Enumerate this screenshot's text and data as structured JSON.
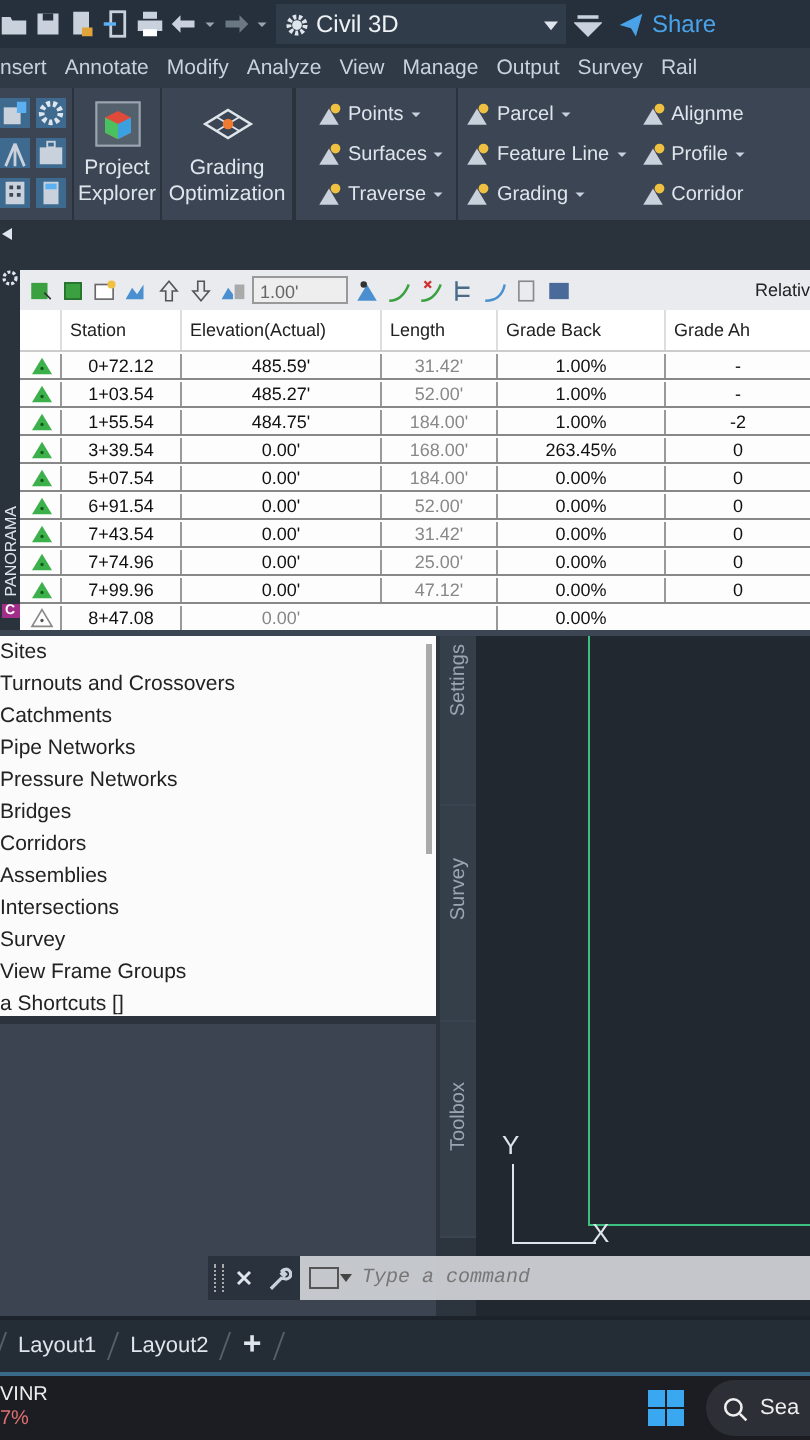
{
  "title_bar": {
    "workspace": "Civil 3D",
    "share": "Share"
  },
  "menu_tabs": [
    "nsert",
    "Annotate",
    "Modify",
    "Analyze",
    "View",
    "Manage",
    "Output",
    "Survey",
    "Rail"
  ],
  "ribbon": {
    "big_buttons": [
      {
        "label": "Project Explorer",
        "kind": "explorer"
      },
      {
        "label": "Grading Optimization",
        "kind": "grading"
      }
    ],
    "tool_columns": [
      [
        {
          "label": "Points",
          "dropdown": true
        },
        {
          "label": "Surfaces",
          "dropdown": true
        },
        {
          "label": "Traverse",
          "dropdown": true
        }
      ],
      [
        {
          "label": "Parcel",
          "dropdown": true
        },
        {
          "label": "Feature Line",
          "dropdown": true
        },
        {
          "label": "Grading",
          "dropdown": true
        }
      ],
      [
        {
          "label": "Alignme",
          "dropdown": false
        },
        {
          "label": "Profile",
          "dropdown": true
        },
        {
          "label": "Corridor",
          "dropdown": false
        }
      ]
    ]
  },
  "panorama": {
    "title": "PANORAMA",
    "badge": "C",
    "toolbar": {
      "value": "1.00'",
      "relative": "Relativ"
    },
    "columns": [
      "Station",
      "Elevation(Actual)",
      "Length",
      "Grade Back",
      "Grade Ah"
    ],
    "rows": [
      {
        "kind": "pvi",
        "cells": [
          "0+72.12",
          "485.59'",
          "31.42'",
          "1.00%",
          "-"
        ]
      },
      {
        "kind": "pvi",
        "cells": [
          "1+03.54",
          "485.27'",
          "52.00'",
          "1.00%",
          "-"
        ]
      },
      {
        "kind": "pvi",
        "cells": [
          "1+55.54",
          "484.75'",
          "184.00'",
          "1.00%",
          "-2"
        ]
      },
      {
        "kind": "pvi",
        "cells": [
          "3+39.54",
          "0.00'",
          "168.00'",
          "263.45%",
          "0"
        ]
      },
      {
        "kind": "pvi",
        "cells": [
          "5+07.54",
          "0.00'",
          "184.00'",
          "0.00%",
          "0"
        ]
      },
      {
        "kind": "pvi",
        "cells": [
          "6+91.54",
          "0.00'",
          "52.00'",
          "0.00%",
          "0"
        ]
      },
      {
        "kind": "pvi",
        "cells": [
          "7+43.54",
          "0.00'",
          "31.42'",
          "0.00%",
          "0"
        ]
      },
      {
        "kind": "pvi",
        "cells": [
          "7+74.96",
          "0.00'",
          "25.00'",
          "0.00%",
          "0"
        ]
      },
      {
        "kind": "pvi",
        "cells": [
          "7+99.96",
          "0.00'",
          "47.12'",
          "0.00%",
          "0"
        ]
      },
      {
        "kind": "end",
        "cells": [
          "8+47.08",
          "0.00'",
          "",
          "0.00%",
          ""
        ]
      }
    ]
  },
  "prospector_items": [
    "Sites",
    "Turnouts and Crossovers",
    "Catchments",
    "Pipe Networks",
    "Pressure Networks",
    "Bridges",
    "Corridors",
    "Assemblies",
    "Intersections",
    "Survey",
    "View Frame Groups",
    "a Shortcuts []"
  ],
  "side_tabs": [
    "Settings",
    "Survey",
    "Toolbox"
  ],
  "ucs": {
    "y": "Y",
    "x": "X"
  },
  "command_line": {
    "placeholder": "Type a command"
  },
  "layout_tabs": [
    "Layout1",
    "Layout2"
  ],
  "add_tab": "+",
  "taskbar": {
    "ticker": "VINR",
    "change": "7%",
    "search": "Sea"
  }
}
